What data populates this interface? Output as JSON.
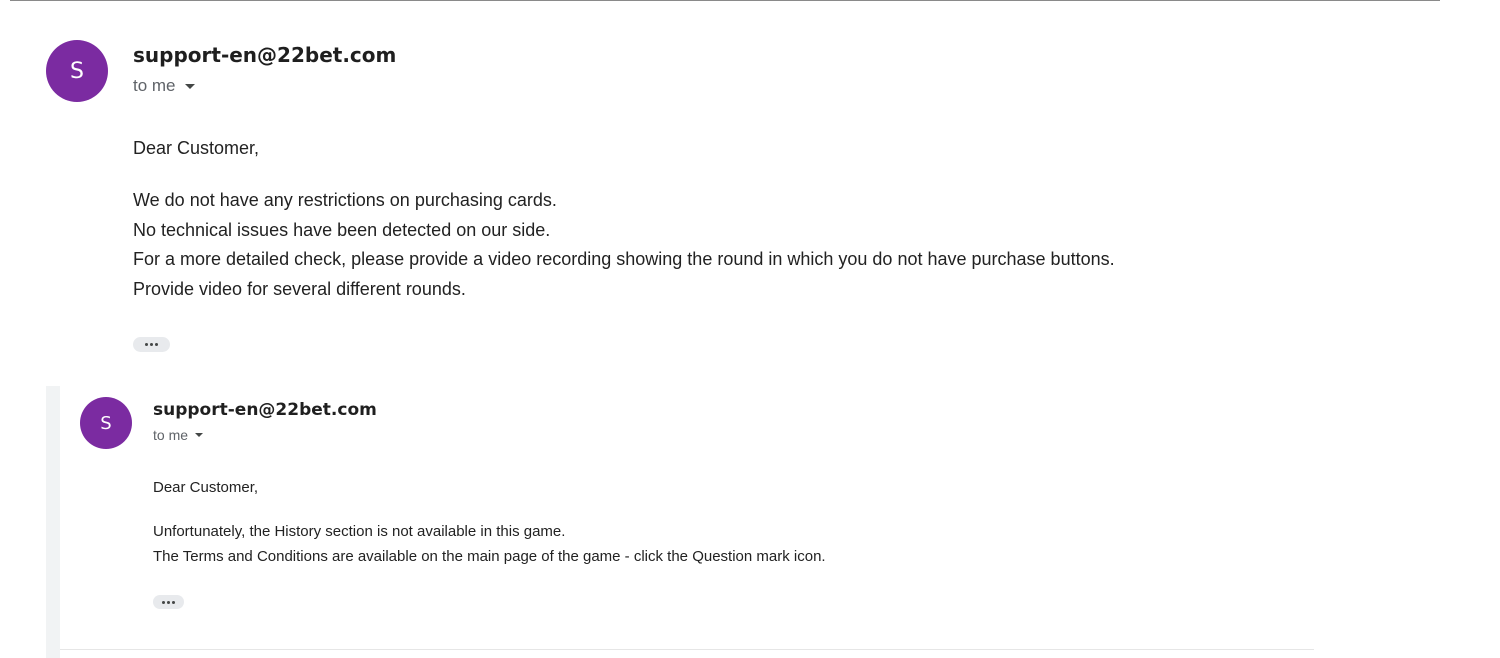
{
  "messages": [
    {
      "avatar_letter": "S",
      "avatar_color": "#7b2ba1",
      "sender": "support-en@22bet.com",
      "recipient": "to me",
      "greeting": "Dear Customer,",
      "lines": [
        "We do not have any restrictions on purchasing cards.",
        "No technical issues have been detected on our side.",
        "For a more detailed check, please provide a video recording showing the round in which you do not have purchase buttons.",
        "Provide video for several different rounds."
      ]
    },
    {
      "avatar_letter": "S",
      "avatar_color": "#7b2ba1",
      "sender": "support-en@22bet.com",
      "recipient": "to me",
      "greeting": "Dear Customer,",
      "lines": [
        "Unfortunately, the History section is not available in this game.",
        "The Terms and Conditions are available on the main page of the game - click the Question mark icon."
      ]
    }
  ]
}
